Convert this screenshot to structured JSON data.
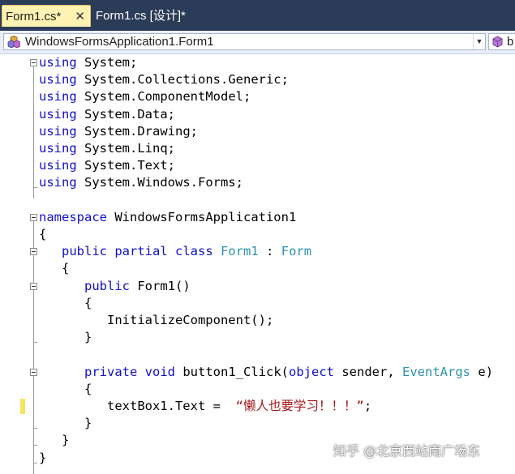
{
  "tabs": [
    {
      "label": "Form1.cs*",
      "close": "✕",
      "active": true
    },
    {
      "label": "Form1.cs [设计]*",
      "active": false
    }
  ],
  "navbar": {
    "class_selected": "WindowsFormsApplication1.Form1",
    "member_selected": "b",
    "class_icon": "class-icon",
    "member_icon": "method-icon"
  },
  "colors": {
    "keyword": "#1010c8",
    "type": "#2b91af",
    "string": "#a31515",
    "tab_active_bg": "#fff2b3",
    "tabstrip_bg": "#2b3c59",
    "change_marker": "#f4e460"
  },
  "code": {
    "lines": [
      [
        [
          "kw",
          "using"
        ],
        [
          "",
          "System;"
        ]
      ],
      [
        [
          "kw",
          "using"
        ],
        [
          "",
          "System.Collections.Generic;"
        ]
      ],
      [
        [
          "kw",
          "using"
        ],
        [
          "",
          "System.ComponentModel;"
        ]
      ],
      [
        [
          "kw",
          "using"
        ],
        [
          "",
          "System.Data;"
        ]
      ],
      [
        [
          "kw",
          "using"
        ],
        [
          "",
          "System.Drawing;"
        ]
      ],
      [
        [
          "kw",
          "using"
        ],
        [
          "",
          "System.Linq;"
        ]
      ],
      [
        [
          "kw",
          "using"
        ],
        [
          "",
          "System.Text;"
        ]
      ],
      [
        [
          "kw",
          "using"
        ],
        [
          "",
          "System.Windows.Forms;"
        ]
      ],
      [],
      [
        [
          "kw",
          "namespace"
        ],
        [
          "",
          "WindowsFormsApplication1"
        ]
      ],
      [
        [
          "",
          "{"
        ]
      ],
      [
        [
          "",
          "   "
        ],
        [
          "kw",
          "public"
        ],
        [
          "kw",
          "partial"
        ],
        [
          "kw",
          "class"
        ],
        [
          "ty",
          "Form1"
        ],
        [
          "",
          ":"
        ],
        [
          "ty",
          "Form"
        ]
      ],
      [
        [
          "",
          "   {"
        ]
      ],
      [
        [
          "",
          "      "
        ],
        [
          "kw",
          "public"
        ],
        [
          "",
          "Form1()"
        ]
      ],
      [
        [
          "",
          "      {"
        ]
      ],
      [
        [
          "",
          "         InitializeComponent();"
        ]
      ],
      [
        [
          "",
          "      }"
        ]
      ],
      [],
      [
        [
          "",
          "      "
        ],
        [
          "kw",
          "private"
        ],
        [
          "kw",
          "void"
        ],
        [
          "",
          "button1_Click("
        ],
        [
          "kw",
          "object"
        ],
        [
          "",
          "sender,"
        ],
        [
          "ty",
          "EventArgs"
        ],
        [
          "",
          "e)"
        ]
      ],
      [
        [
          "",
          "      {"
        ]
      ],
      [
        [
          "",
          "         textBox1.Text = "
        ],
        [
          "st",
          "“懒人也要学习！！！”"
        ],
        [
          "",
          ";"
        ]
      ],
      [
        [
          "",
          "      }"
        ]
      ],
      [
        [
          "",
          "   }"
        ]
      ],
      [
        [
          "",
          "}"
        ]
      ]
    ]
  },
  "watermark": "知乎 @北京西站南广场东"
}
